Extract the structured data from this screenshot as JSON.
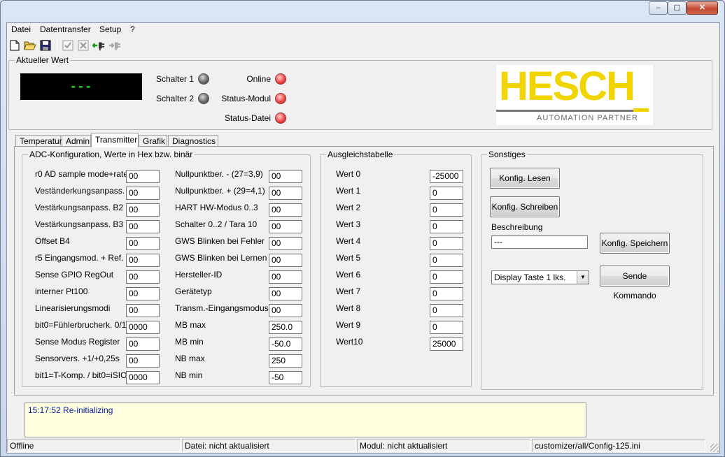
{
  "window": {
    "minimize_glyph": "‒",
    "maximize_glyph": "▢",
    "close_glyph": "✕"
  },
  "menu": [
    "Datei",
    "Datentransfer",
    "Setup",
    "?"
  ],
  "toolbar_icons": [
    "new-file-icon",
    "open-folder-icon",
    "save-icon",
    "check-icon",
    "cross-icon",
    "connect-icon",
    "disconnect-icon"
  ],
  "current_value": {
    "legend": "Aktueller Wert",
    "display": "---",
    "leds": [
      {
        "label": "Schalter 1",
        "state": "gray"
      },
      {
        "label": "Schalter 2",
        "state": "gray"
      },
      {
        "label": "Online",
        "state": "red"
      },
      {
        "label": "Status-Modul",
        "state": "red"
      },
      {
        "label": "Status-Datei",
        "state": "red"
      }
    ]
  },
  "logo": {
    "text": "HESCH",
    "subtitle": "AUTOMATION PARTNER",
    "color": "#f2d500"
  },
  "tabs": [
    "Temperatur",
    "Admin",
    "Transmitter",
    "Grafik",
    "Diagnostics"
  ],
  "active_tab": "Transmitter",
  "adc": {
    "legend": "ADC-Konfiguration, Werte in Hex bzw. binär",
    "left": [
      {
        "label": "r0 AD sample mode+rate",
        "value": "00"
      },
      {
        "label": "Veständerkungsanpass. B1",
        "value": "00"
      },
      {
        "label": "Vestärkungsanpass. B2",
        "value": "00"
      },
      {
        "label": "Vestärkungsanpass. B3",
        "value": "00"
      },
      {
        "label": "Offset B4",
        "value": "00"
      },
      {
        "label": "r5 Eingangsmod. + Ref.",
        "value": "00"
      },
      {
        "label": "Sense GPIO RegOut",
        "value": "00"
      },
      {
        "label": "interner Pt100",
        "value": "00"
      },
      {
        "label": "Linearisierungsmodi",
        "value": "00"
      },
      {
        "label": "bit0=Fühlerbrucherk. 0/1",
        "value": "0000"
      },
      {
        "label": "Sense Modus Register",
        "value": "00"
      },
      {
        "label": "Sensorvers. +1/+0,25s",
        "value": "00"
      },
      {
        "label": "bit1=T-Komp. / bit0=iSIO",
        "value": "0000"
      }
    ],
    "right": [
      {
        "label": "Nullpunktber. - (27=3,9)",
        "value": "00"
      },
      {
        "label": "Nullpunktber. + (29=4,1)",
        "value": "00"
      },
      {
        "label": "HART HW-Modus 0..3",
        "value": "00"
      },
      {
        "label": "Schalter 0..2 / Tara 10",
        "value": "00"
      },
      {
        "label": "GWS Blinken bei Fehler",
        "value": "00"
      },
      {
        "label": "GWS Blinken bei Lernen",
        "value": "00"
      },
      {
        "label": "Hersteller-ID",
        "value": "00"
      },
      {
        "label": "Gerätetyp",
        "value": "00"
      },
      {
        "label": "Transm.-Eingangsmodus",
        "value": "00"
      },
      {
        "label": "MB max",
        "value": "250.0"
      },
      {
        "label": "MB min",
        "value": "-50.0"
      },
      {
        "label": "NB max",
        "value": "250"
      },
      {
        "label": "NB min",
        "value": "-50"
      }
    ]
  },
  "ausgleich": {
    "legend": "Ausgleichstabelle",
    "rows": [
      {
        "label": "Wert 0",
        "value": "-25000"
      },
      {
        "label": "Wert 1",
        "value": "0"
      },
      {
        "label": "Wert 2",
        "value": "0"
      },
      {
        "label": "Wert 3",
        "value": "0"
      },
      {
        "label": "Wert 4",
        "value": "0"
      },
      {
        "label": "Wert 5",
        "value": "0"
      },
      {
        "label": "Wert 6",
        "value": "0"
      },
      {
        "label": "Wert 7",
        "value": "0"
      },
      {
        "label": "Wert 8",
        "value": "0"
      },
      {
        "label": "Wert 9",
        "value": "0"
      },
      {
        "label": "Wert10",
        "value": "25000"
      }
    ]
  },
  "sonstiges": {
    "legend": "Sonstiges",
    "read_button": "Konfig. Lesen",
    "write_button": "Konfig. Schreiben",
    "description_label": "Beschreibung",
    "description_value": "---",
    "save_button": "Konfig. Speichern",
    "command_select": "Display Taste 1 lks.",
    "send_button": "Sende Kommando"
  },
  "log": "15:17:52 Re-initializing",
  "status": [
    "Offline",
    "Datei: nicht aktualisiert",
    "Modul: nicht aktualisiert",
    "customizer/all/Config-125.ini"
  ]
}
